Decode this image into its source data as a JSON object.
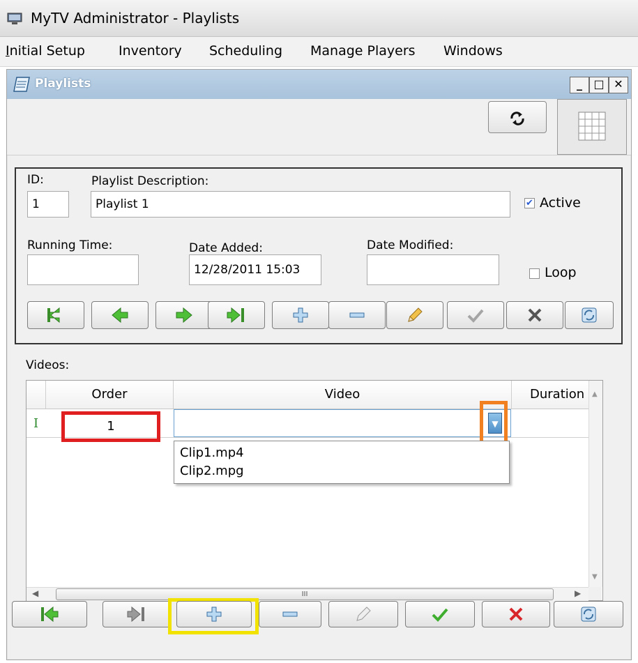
{
  "window": {
    "title": "MyTV Administrator - Playlists"
  },
  "menu": [
    {
      "accel": "I",
      "rest": "nitial Setup"
    },
    {
      "accel": "",
      "rest": "Inventory"
    },
    {
      "accel": "",
      "rest": "Scheduling"
    },
    {
      "accel": "",
      "rest": "Manage Players"
    },
    {
      "accel": "",
      "rest": "Windows"
    }
  ],
  "child": {
    "title": "Playlists"
  },
  "form": {
    "id_label": "ID:",
    "id_value": "1",
    "desc_label": "Playlist Description:",
    "desc_value": "Playlist 1",
    "active_label": "Active",
    "active_checked": true,
    "running_label": "Running Time:",
    "running_value": "",
    "added_label": "Date Added:",
    "added_value": "12/28/2011 15:03",
    "modified_label": "Date Modified:",
    "modified_value": "",
    "loop_label": "Loop",
    "loop_checked": false
  },
  "videos": {
    "label": "Videos:",
    "columns": [
      "Order",
      "Video",
      "Duration"
    ],
    "row": {
      "order": "1",
      "video": "",
      "duration": ""
    },
    "dropdown": [
      "Clip1.mp4",
      "Clip2.mpg"
    ],
    "hscroll_mark": "III"
  },
  "colors": {
    "red_highlight": "#e02020",
    "orange_highlight": "#f08020",
    "yellow_highlight": "#f2e200"
  }
}
